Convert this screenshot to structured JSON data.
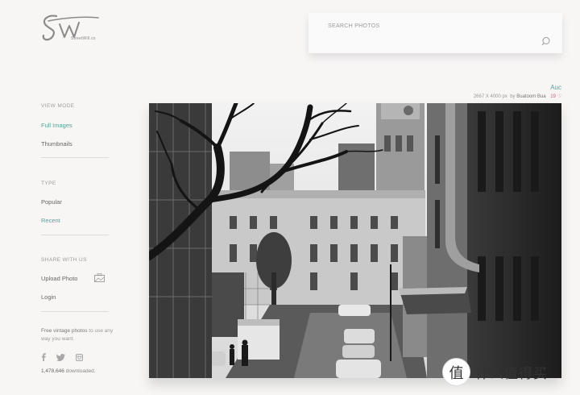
{
  "logo": {
    "subtitle": "StreetWill.co"
  },
  "search": {
    "placeholder": "SEARCH PHOTOS"
  },
  "sidebar": {
    "view_mode": {
      "title": "VIEW MODE",
      "items": [
        "Full Images",
        "Thumbnails"
      ],
      "active": "Full Images"
    },
    "type": {
      "title": "TYPE",
      "items": [
        "Popular",
        "Recent"
      ],
      "active": "Recent"
    },
    "share": {
      "title": "SHARE WITH US",
      "upload": "Upload Photo",
      "login": "Login"
    },
    "note": {
      "text1": "Free vintage photos",
      "text2": " to use any way you want."
    },
    "social_icons": [
      "facebook-icon",
      "twitter-icon",
      "instagram-icon"
    ],
    "downloads": {
      "number": "1,478,646",
      "suffix": " downloaded."
    }
  },
  "photo": {
    "title": "Auc",
    "dimensions": "2667 X 4000 px",
    "by": "by",
    "author": "Buatoom Bua",
    "likes": "19 ♡"
  },
  "watermark": {
    "glyph": "值",
    "text": "什么值得买"
  },
  "colors": {
    "accent": "#5aa19a",
    "likes": "#d05a6e",
    "background": "#f7f6f5"
  }
}
